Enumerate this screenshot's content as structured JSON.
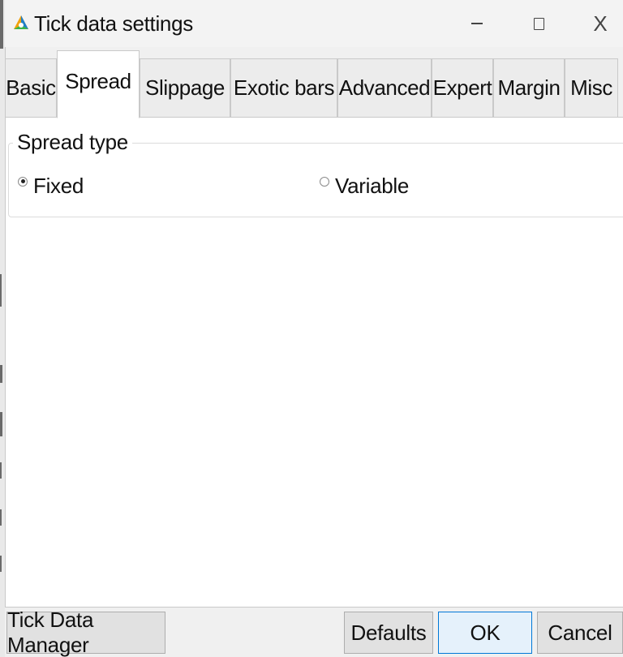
{
  "window": {
    "title": "Tick data settings",
    "controls": {
      "minimize": "–",
      "maximize": "□",
      "close": "X"
    }
  },
  "tabs": [
    {
      "label": "Basic",
      "active": false
    },
    {
      "label": "Spread",
      "active": true
    },
    {
      "label": "Slippage",
      "active": false
    },
    {
      "label": "Exotic bars",
      "active": false
    },
    {
      "label": "Advanced",
      "active": false
    },
    {
      "label": "Expert",
      "active": false
    },
    {
      "label": "Margin",
      "active": false
    },
    {
      "label": "Misc",
      "active": false
    }
  ],
  "spread_group": {
    "legend": "Spread type",
    "options": [
      {
        "label": "Fixed",
        "checked": true
      },
      {
        "label": "Variable",
        "checked": false
      }
    ]
  },
  "buttons": {
    "tick_data_manager": "Tick Data Manager",
    "defaults": "Defaults",
    "ok": "OK",
    "cancel": "Cancel"
  },
  "colors": {
    "accent_border": "#0078d7",
    "default_button_bg": "#e5f1fb",
    "window_bg": "#f0f0f0",
    "pane_bg": "#ffffff"
  }
}
